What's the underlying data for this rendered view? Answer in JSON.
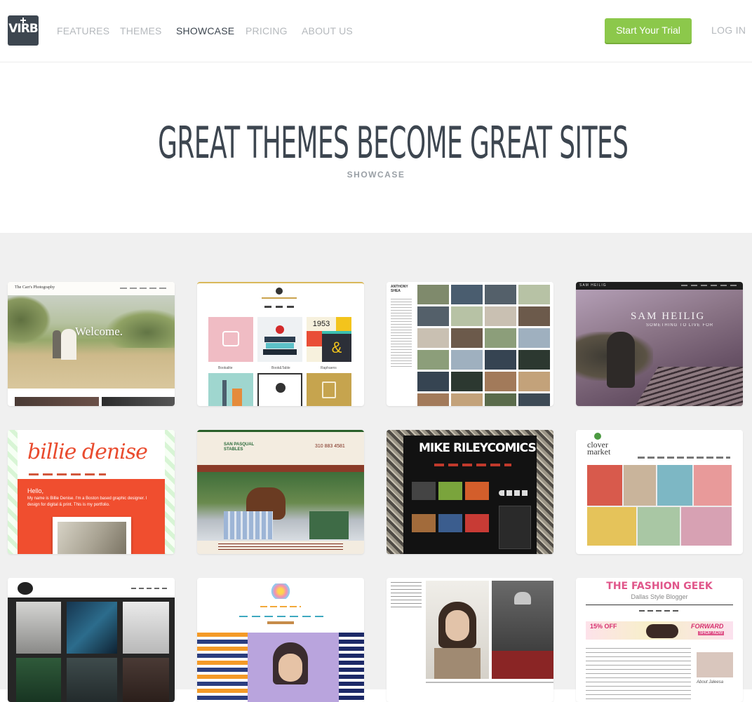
{
  "header": {
    "logo_text": "VIRB",
    "nav": [
      "FEATURES",
      "THEMES",
      "SHOWCASE",
      "PRICING",
      "ABOUT US"
    ],
    "active_nav": "SHOWCASE",
    "cta_label": "Start Your Trial",
    "login_label": "LOG IN"
  },
  "hero": {
    "title": "GREAT THEMES BECOME GREAT SITES",
    "subtitle": "SHOWCASE"
  },
  "showcase": {
    "carr": {
      "brand": "The Carr's Photography",
      "welcome": "Welcome."
    },
    "illustration": {
      "labels": [
        "Bookalite",
        "Book&Table",
        "Raphaens"
      ],
      "year": "1953"
    },
    "anthony": {
      "name": "ANTHONY SHEA"
    },
    "sam": {
      "brand": "SAM HEILIG",
      "title": "SAM HEILIG",
      "tagline": "SOMETHING TO LIVE FOR"
    },
    "billie": {
      "title": "billie denise",
      "hello": "Hello,",
      "intro": "My name is Billie Denise. I'm a Boston based graphic designer. I design for digital & print. This is my portfolio."
    },
    "stables": {
      "name": "SAN PASQUAL STABLES",
      "phone": "310 883 4581"
    },
    "comics": {
      "title": "MIKE RILEYCOMICS"
    },
    "clover": {
      "name": "clover market"
    },
    "fashion": {
      "title": "THE FASHION GEEK",
      "subtitle": "Dallas Style Blogger",
      "promo": "15% OFF",
      "forward": "FORWARD",
      "shop": "SHOP NOW",
      "about": "About Jaleesa"
    }
  },
  "colors": {
    "brand_dark": "#3d4650",
    "accent_green": "#8cc84b",
    "nav_gray": "#b5b9bd",
    "gallery_bg": "#f0f0f0"
  }
}
